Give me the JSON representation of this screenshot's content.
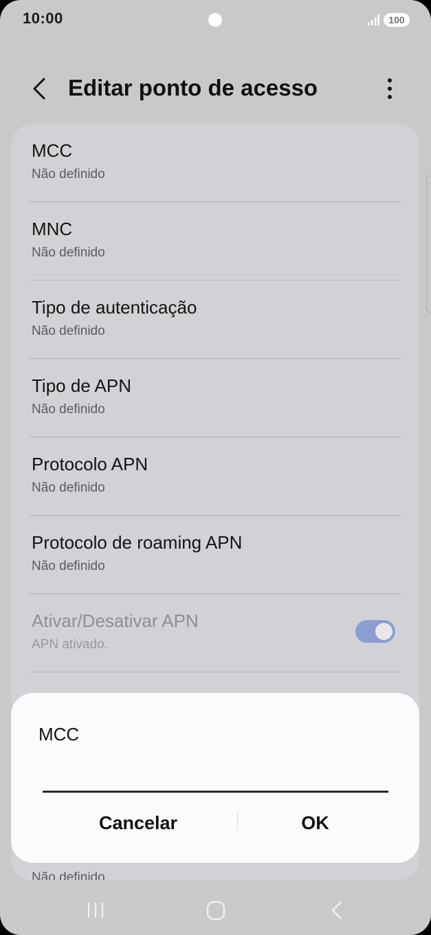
{
  "status_bar": {
    "time": "10:00",
    "battery": "100",
    "signal_icon": "signal-bars-icon",
    "camera_icon": "camera-dot-icon"
  },
  "header": {
    "title": "Editar ponto de acesso",
    "back_icon": "chevron-left-icon",
    "more_icon": "more-vertical-icon"
  },
  "settings_items": [
    {
      "title": "MCC",
      "subtitle": "Não definido"
    },
    {
      "title": "MNC",
      "subtitle": "Não definido"
    },
    {
      "title": "Tipo de autenticação",
      "subtitle": "Não definido"
    },
    {
      "title": "Tipo de APN",
      "subtitle": "Não definido"
    },
    {
      "title": "Protocolo APN",
      "subtitle": "Não definido"
    },
    {
      "title": "Protocolo de roaming APN",
      "subtitle": "Não definido"
    },
    {
      "title": "Ativar/Desativar APN",
      "subtitle": "APN ativado.",
      "toggle_on": true
    }
  ],
  "dialog": {
    "title": "MCC",
    "input_value": "",
    "cancel_label": "Cancelar",
    "ok_label": "OK"
  },
  "bottom_partial": {
    "subtitle": "Não definido"
  },
  "nav_bar": {
    "recent_icon": "recent-apps-icon",
    "home_icon": "home-icon",
    "back_icon": "back-icon"
  },
  "colors": {
    "background": "#c9c9cc",
    "card": "#d2d2d6",
    "toggle_on": "#8a9ed0",
    "dialog": "#fbfbfe"
  }
}
